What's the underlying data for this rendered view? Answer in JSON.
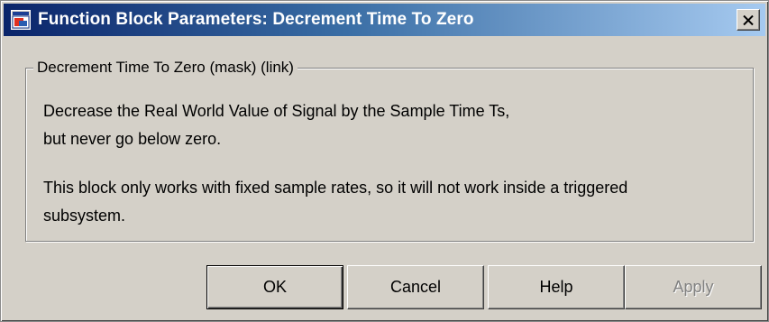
{
  "window": {
    "title": "Function Block Parameters: Decrement Time To Zero",
    "icon": "simulink-block-icon",
    "close_icon": "close-icon"
  },
  "group": {
    "legend": "Decrement Time To Zero (mask) (link)",
    "description_lines": [
      "Decrease the Real World Value of Signal by the Sample Time Ts,",
      "but never go below zero.",
      "This block only works with fixed sample rates, so it will not work inside a triggered",
      "subsystem."
    ]
  },
  "buttons": {
    "ok": "OK",
    "cancel": "Cancel",
    "help": "Help",
    "apply": "Apply"
  },
  "colors": {
    "face": "#d4d0c8",
    "title_start": "#0a246a",
    "title_end": "#a6caf0",
    "disabled_text": "#808080"
  }
}
